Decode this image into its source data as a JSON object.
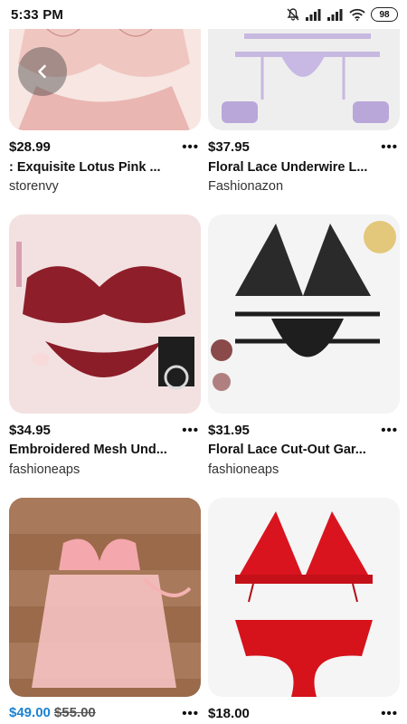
{
  "status_bar": {
    "time": "5:33 PM",
    "battery": "98",
    "icons": [
      "mute-icon",
      "signal-icon",
      "signal-icon",
      "wifi-icon",
      "battery-icon"
    ]
  },
  "products": [
    {
      "price": "$28.99",
      "title": ":  Exquisite Lotus Pink ...",
      "store": "storenvy"
    },
    {
      "price": "$37.95",
      "title": "Floral Lace Underwire L...",
      "store": "Fashionazon"
    },
    {
      "price": "$34.95",
      "title": "Embroidered Mesh Und...",
      "store": "fashioneaps"
    },
    {
      "price": "$31.95",
      "title": "Floral Lace Cut-Out Gar...",
      "store": "fashioneaps"
    },
    {
      "price": "$49.00",
      "old_price": "$55.00",
      "title": "",
      "store": ""
    },
    {
      "price": "$18.00",
      "title": "",
      "store": ""
    }
  ],
  "more_label": "•••",
  "colors": {
    "sale_price": "#1b82d1",
    "text": "#111111"
  }
}
